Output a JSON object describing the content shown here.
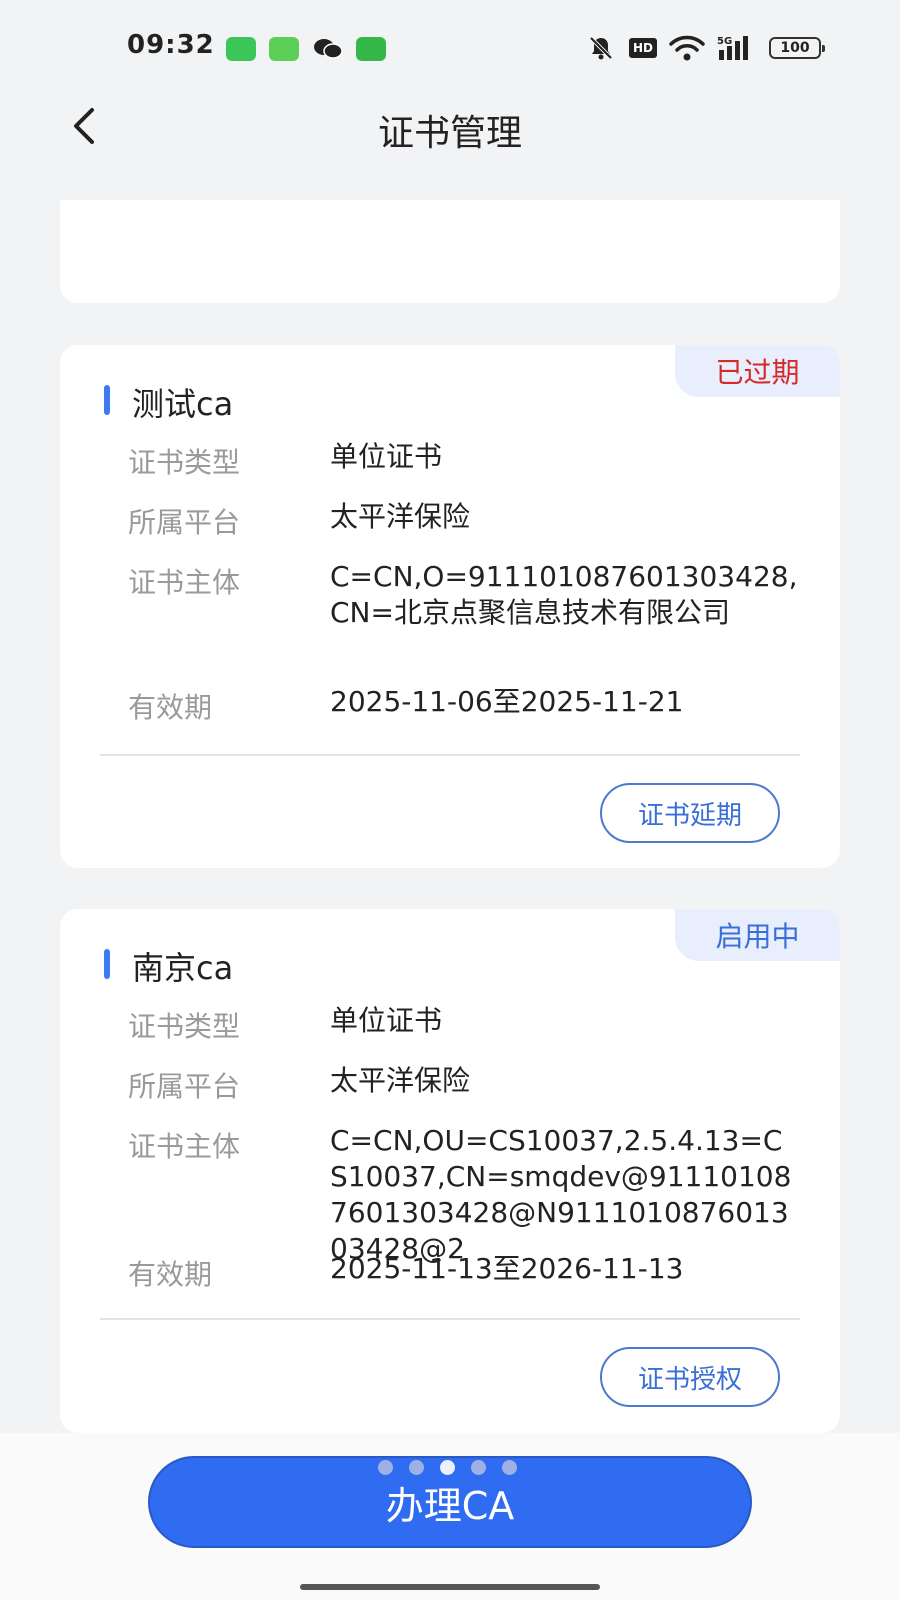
{
  "status_bar": {
    "time": "09:32",
    "hd": "HD",
    "network": "5G",
    "battery": "100"
  },
  "nav": {
    "title": "证书管理"
  },
  "certs": [
    {
      "name": "测试ca",
      "status": "已过期",
      "fields": [
        {
          "label": "证书类型",
          "value": "单位证书"
        },
        {
          "label": "所属平台",
          "value": "太平洋保险"
        },
        {
          "label": "证书主体",
          "value": "C=CN,O=911101087601303428,CN=北京点聚信息技术有限公司"
        },
        {
          "label": "有效期",
          "value": "2025-11-06至2025-11-21"
        }
      ],
      "action": "证书延期"
    },
    {
      "name": "南京ca",
      "status": "启用中",
      "fields": [
        {
          "label": "证书类型",
          "value": "单位证书"
        },
        {
          "label": "所属平台",
          "value": "太平洋保险"
        },
        {
          "label": "证书主体",
          "value": "C=CN,OU=CS10037,2.5.4.13=CS10037,CN=smqdev@911101087601303428@N911101087601303428@2"
        },
        {
          "label": "有效期",
          "value": "2025-11-13至2026-11-13"
        }
      ],
      "action": "证书授权"
    }
  ],
  "primary_button": "办理CA",
  "colors": {
    "accent": "#2f6cf1",
    "expired": "#d42a2a",
    "active": "#3a6fd8"
  }
}
